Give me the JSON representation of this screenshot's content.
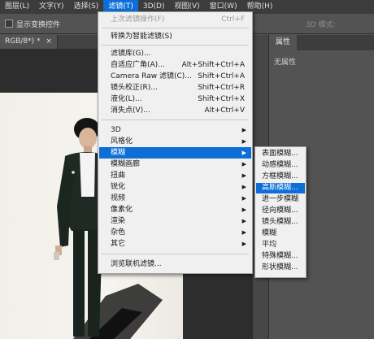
{
  "menubar": {
    "items": [
      {
        "label": "图层(L)"
      },
      {
        "label": "文字(Y)"
      },
      {
        "label": "选择(S)"
      },
      {
        "label": "滤镜(T)"
      },
      {
        "label": "3D(D)"
      },
      {
        "label": "视图(V)"
      },
      {
        "label": "窗口(W)"
      },
      {
        "label": "帮助(H)"
      }
    ],
    "active_index": 3
  },
  "options": {
    "show_transform_label": "显示变换控件",
    "mode_3d_label": "3D 模式:"
  },
  "document": {
    "tab_label": "RGB/8*) *",
    "close_label": "×"
  },
  "panel": {
    "tab_label": "属性",
    "content_text": "无属性"
  },
  "filter_menu": {
    "top_items": [
      {
        "label": "上次滤镜操作(F)",
        "shortcut": "Ctrl+F",
        "disabled": true
      },
      {
        "label": "转换为智能滤镜(S)",
        "shortcut": ""
      },
      {
        "label": "滤镜库(G)...",
        "shortcut": ""
      },
      {
        "label": "自适应广角(A)...",
        "shortcut": "Alt+Shift+Ctrl+A"
      },
      {
        "label": "Camera Raw 滤镜(C)...",
        "shortcut": "Shift+Ctrl+A"
      },
      {
        "label": "镜头校正(R)...",
        "shortcut": "Shift+Ctrl+R"
      },
      {
        "label": "液化(L)...",
        "shortcut": "Shift+Ctrl+X"
      },
      {
        "label": "消失点(V)...",
        "shortcut": "Alt+Ctrl+V"
      }
    ],
    "sub_items": [
      {
        "label": "3D"
      },
      {
        "label": "风格化"
      },
      {
        "label": "模糊"
      },
      {
        "label": "模糊画廊"
      },
      {
        "label": "扭曲"
      },
      {
        "label": "锐化"
      },
      {
        "label": "视频"
      },
      {
        "label": "像素化"
      },
      {
        "label": "渲染"
      },
      {
        "label": "杂色"
      },
      {
        "label": "其它"
      }
    ],
    "highlighted_sub_index": 2,
    "browse_label": "浏览联机滤镜..."
  },
  "blur_submenu": {
    "items": [
      {
        "label": "表面模糊..."
      },
      {
        "label": "动感模糊..."
      },
      {
        "label": "方框模糊..."
      },
      {
        "label": "高斯模糊..."
      },
      {
        "label": "进一步模糊"
      },
      {
        "label": "径向模糊..."
      },
      {
        "label": "镜头模糊..."
      },
      {
        "label": "模糊"
      },
      {
        "label": "平均"
      },
      {
        "label": "特殊模糊..."
      },
      {
        "label": "形状模糊..."
      }
    ],
    "highlighted_index": 3
  },
  "colors": {
    "highlight": "#0d6ed8",
    "menu_bg": "#f0f0f0",
    "app_bg": "#535353"
  }
}
